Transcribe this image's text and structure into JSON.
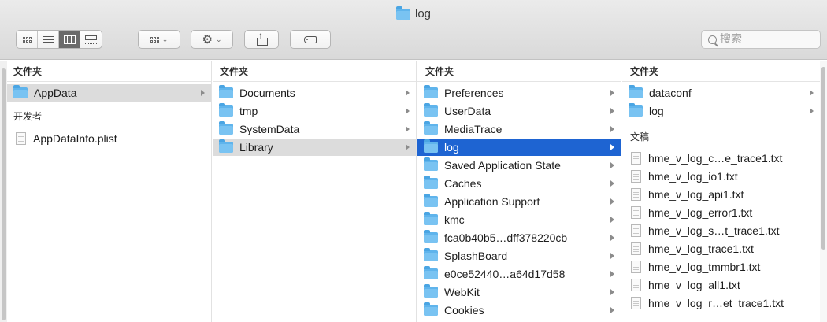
{
  "window": {
    "title": "log"
  },
  "toolbar": {
    "search_placeholder": "搜索"
  },
  "columns": [
    {
      "sections": [
        {
          "header": "文件夹",
          "items": [
            {
              "label": "AppData",
              "type": "folder",
              "state": "selected-inactive",
              "arrow": true
            }
          ]
        },
        {
          "header": "开发者",
          "items": [
            {
              "label": "AppDataInfo.plist",
              "type": "file"
            }
          ]
        }
      ]
    },
    {
      "sections": [
        {
          "header": "文件夹",
          "items": [
            {
              "label": "Documents",
              "type": "folder",
              "arrow": true
            },
            {
              "label": "tmp",
              "type": "folder",
              "arrow": true
            },
            {
              "label": "SystemData",
              "type": "folder",
              "arrow": true
            },
            {
              "label": "Library",
              "type": "folder",
              "state": "selected-inactive",
              "arrow": true
            }
          ]
        }
      ]
    },
    {
      "sections": [
        {
          "header": "文件夹",
          "items": [
            {
              "label": "Preferences",
              "type": "folder",
              "arrow": true
            },
            {
              "label": "UserData",
              "type": "folder",
              "arrow": true
            },
            {
              "label": "MediaTrace",
              "type": "folder",
              "arrow": true
            },
            {
              "label": "log",
              "type": "folder",
              "state": "selected-active",
              "arrow": true
            },
            {
              "label": "Saved Application State",
              "type": "folder",
              "arrow": true
            },
            {
              "label": "Caches",
              "type": "folder",
              "arrow": true
            },
            {
              "label": "Application Support",
              "type": "folder",
              "arrow": true
            },
            {
              "label": "kmc",
              "type": "folder",
              "arrow": true
            },
            {
              "label": "fca0b40b5…dff378220cb",
              "type": "folder",
              "arrow": true
            },
            {
              "label": "SplashBoard",
              "type": "folder",
              "arrow": true
            },
            {
              "label": "e0ce52440…a64d17d58",
              "type": "folder",
              "arrow": true
            },
            {
              "label": "WebKit",
              "type": "folder",
              "arrow": true
            },
            {
              "label": "Cookies",
              "type": "folder",
              "arrow": true
            }
          ]
        }
      ]
    },
    {
      "sections": [
        {
          "header": "文件夹",
          "items": [
            {
              "label": "dataconf",
              "type": "folder",
              "arrow": true
            },
            {
              "label": "log",
              "type": "folder",
              "arrow": true
            }
          ]
        },
        {
          "header": "文稿",
          "items": [
            {
              "label": "hme_v_log_c…e_trace1.txt",
              "type": "file"
            },
            {
              "label": "hme_v_log_io1.txt",
              "type": "file"
            },
            {
              "label": "hme_v_log_api1.txt",
              "type": "file"
            },
            {
              "label": "hme_v_log_error1.txt",
              "type": "file"
            },
            {
              "label": "hme_v_log_s…t_trace1.txt",
              "type": "file"
            },
            {
              "label": "hme_v_log_trace1.txt",
              "type": "file"
            },
            {
              "label": "hme_v_log_tmmbr1.txt",
              "type": "file"
            },
            {
              "label": "hme_v_log_all1.txt",
              "type": "file"
            },
            {
              "label": "hme_v_log_r…et_trace1.txt",
              "type": "file"
            }
          ]
        }
      ]
    }
  ]
}
